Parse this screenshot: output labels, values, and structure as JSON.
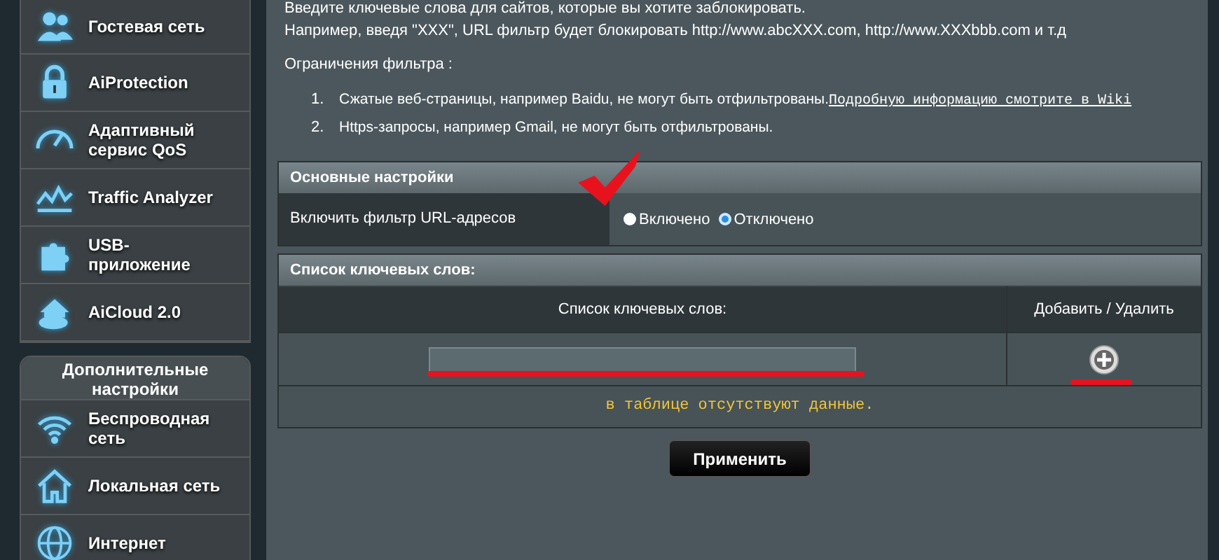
{
  "sidebar": {
    "items": [
      {
        "label": "Гостевая сеть"
      },
      {
        "label": "AiProtection"
      },
      {
        "label": "Адаптивный сервис QoS"
      },
      {
        "label": "Traffic Analyzer"
      },
      {
        "label": "USB-приложение"
      },
      {
        "label": "AiCloud 2.0"
      }
    ],
    "advanced": {
      "title": "Дополнительные настройки",
      "items": [
        {
          "label": "Беспроводная сеть"
        },
        {
          "label": "Локальная сеть"
        },
        {
          "label": "Интернет"
        }
      ]
    }
  },
  "intro": [
    "Введите ключевые слова для сайтов, которые вы хотите заблокировать.",
    "Например, введя \"XXX\", URL фильтр будет блокировать http://www.abcXXX.com, http://www.XXXbbb.com и т.д"
  ],
  "limits_title": "Ограничения фильтра :",
  "limits": [
    {
      "number": "1.",
      "text": "Сжатые веб-страницы, например Baidu, не могут быть отфильтрованы.",
      "link": "Подробную информацию смотрите в Wiki"
    },
    {
      "number": "2.",
      "text": "Https-запросы, например Gmail, не могут быть отфильтрованы."
    }
  ],
  "basic": {
    "title": "Основные настройки",
    "label": "Включить фильтр URL-адресов",
    "options": [
      {
        "label": "Включено",
        "selected": false
      },
      {
        "label": "Отключено",
        "selected": true
      }
    ]
  },
  "keywords": {
    "title": "Список ключевых слов:",
    "columns": [
      "Список ключевых слов:",
      "Добавить / Удалить"
    ],
    "empty": "в таблице отсутствуют данные."
  },
  "apply": "Применить"
}
